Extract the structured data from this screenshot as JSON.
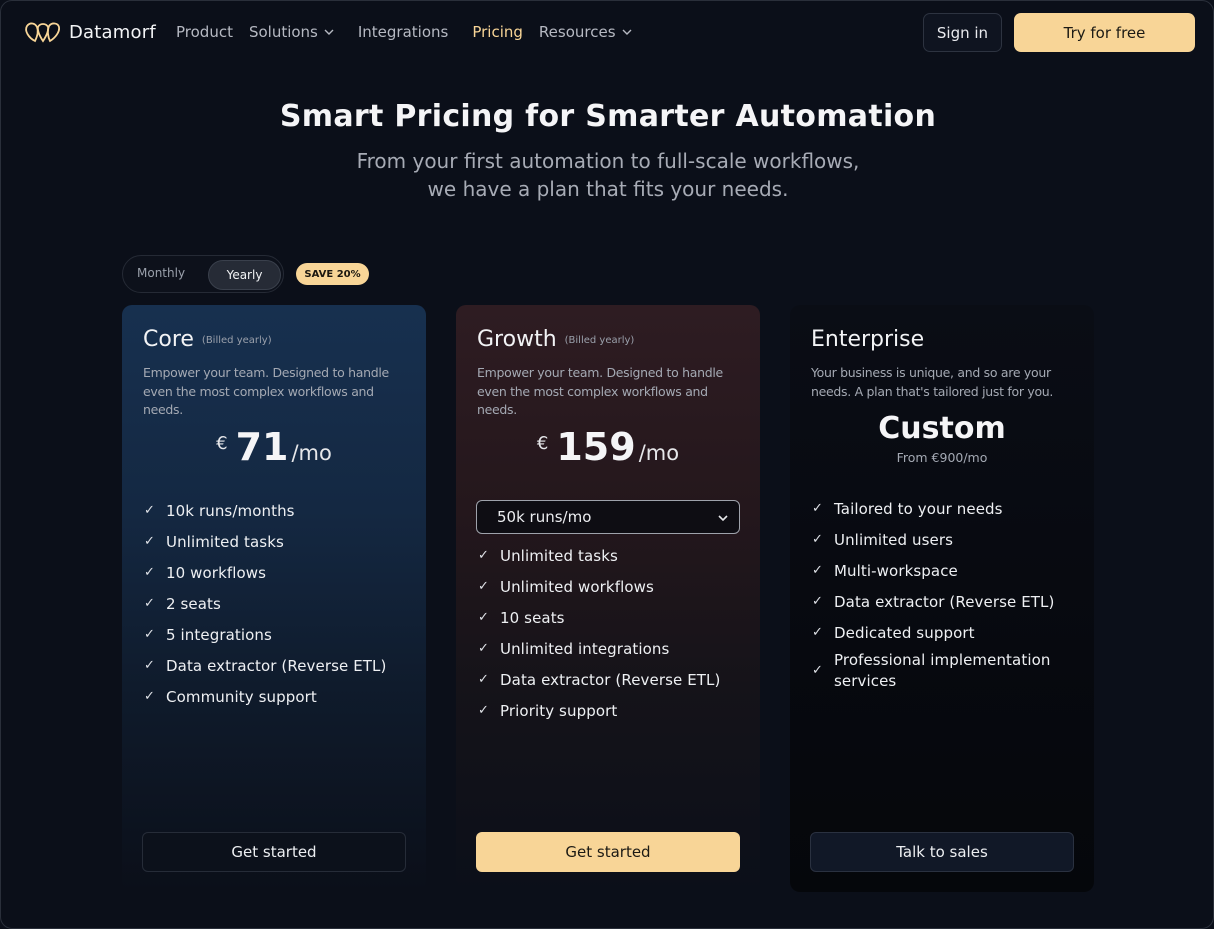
{
  "brand": {
    "name": "Datamorf"
  },
  "nav": {
    "links": [
      {
        "label": "Product",
        "dropdown": false,
        "active": false
      },
      {
        "label": "Solutions",
        "dropdown": true,
        "active": false
      },
      {
        "label": "Integrations",
        "dropdown": false,
        "active": false
      },
      {
        "label": "Pricing",
        "dropdown": false,
        "active": true
      },
      {
        "label": "Resources",
        "dropdown": true,
        "active": false
      }
    ],
    "sign_in": "Sign in",
    "try_free": "Try for free"
  },
  "hero": {
    "title": "Smart Pricing for Smarter Automation",
    "subtitle_line1": "From your first automation to full-scale workflows,",
    "subtitle_line2": "we have a plan that fits your needs."
  },
  "billing_toggle": {
    "monthly": "Monthly",
    "yearly": "Yearly",
    "selected": "Yearly",
    "badge": "SAVE 20%"
  },
  "plans": {
    "core": {
      "name": "Core",
      "billed": "(Billed yearly)",
      "description": "Empower your team. Designed to handle even the most complex workflows and needs.",
      "currency": "€",
      "price": "71",
      "period": "/mo",
      "features": [
        "10k runs/months",
        "Unlimited tasks",
        "10 workflows",
        "2 seats",
        "5 integrations",
        "Data extractor (Reverse ETL)",
        "Community support"
      ],
      "cta": "Get started"
    },
    "growth": {
      "name": "Growth",
      "billed": "(Billed yearly)",
      "description": "Empower your team. Designed to handle even the most complex workflows and needs.",
      "currency": "€",
      "price": "159",
      "period": "/mo",
      "runs_selected": "50k runs/mo",
      "features": [
        "Unlimited tasks",
        "Unlimited workflows",
        "10 seats",
        "Unlimited integrations",
        "Data extractor (Reverse ETL)",
        "Priority support"
      ],
      "cta": "Get started"
    },
    "enterprise": {
      "name": "Enterprise",
      "description": "Your business is unique, and so are your needs. A plan that's tailored just for you.",
      "price": "Custom",
      "from_price": "From €900/mo",
      "features": [
        "Tailored to your needs",
        "Unlimited users",
        "Multi-workspace",
        "Data extractor (Reverse ETL)",
        "Dedicated support",
        "Professional implementation services"
      ],
      "cta": "Talk to sales"
    }
  },
  "colors": {
    "accent": "#f8d597",
    "background": "#0b0f19",
    "core_card": "#17304f",
    "growth_card": "#2e1c22"
  }
}
